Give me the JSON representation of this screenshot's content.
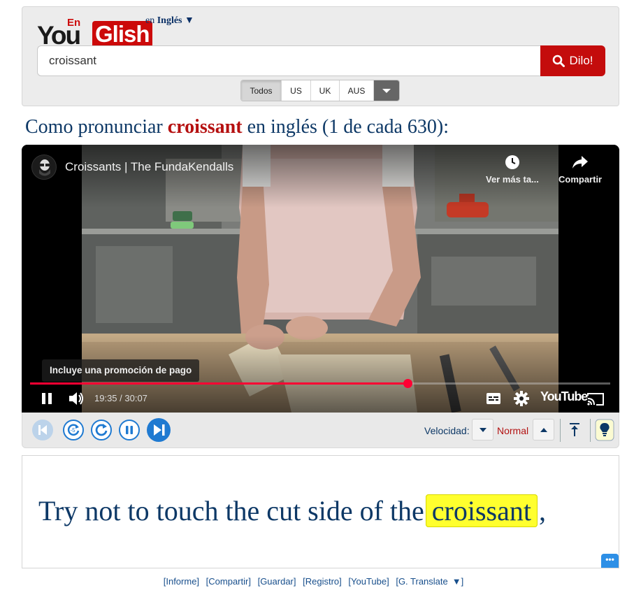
{
  "header": {
    "logo_you": "You",
    "logo_en": "En",
    "logo_glish": "Glish",
    "lang_prefix": "en",
    "lang_name": "Inglés",
    "lang_caret": "▼",
    "search_value": "croissant",
    "search_button": "Dilo!",
    "accents": [
      "Todos",
      "US",
      "UK",
      "AUS"
    ],
    "accent_selected": "Todos"
  },
  "heading": {
    "prefix": "Como pronunciar",
    "word": "croissant",
    "suffix": "en inglés (1 de cada 630):"
  },
  "video": {
    "title": "Croissants | The FundaKendalls",
    "watch_later": "Ver más ta...",
    "share": "Compartir",
    "promo": "Incluye una promoción de pago",
    "time": "19:35 / 30:07",
    "progress_fraction": 0.65,
    "brand": "YouTube"
  },
  "controls": {
    "speed_label": "Velocidad:",
    "speed_value": "Normal"
  },
  "caption": {
    "before": "Try not to touch the cut side of the",
    "highlight": "croissant",
    "after": ","
  },
  "footer": {
    "links": [
      "[Informe]",
      "[Compartir]",
      "[Guardar]",
      "[Registro]",
      "[YouTube]",
      "[G. Translate"
    ],
    "close": "]"
  },
  "colors": {
    "brand_red": "#c40c0c",
    "heading_blue": "#0d3866",
    "highlight_yellow": "#ffff2e",
    "progress_red": "#ff0033",
    "player_blue": "#1f7ad1"
  }
}
